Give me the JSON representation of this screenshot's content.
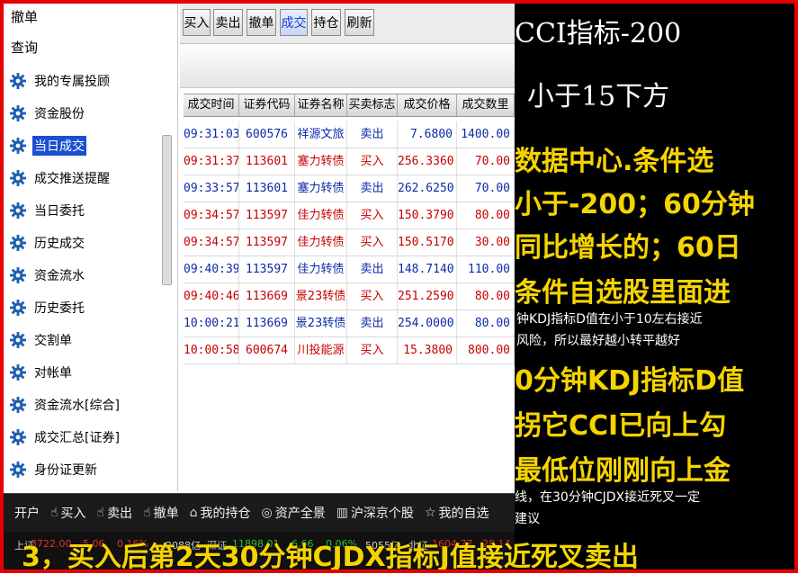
{
  "sidebar": {
    "top_items": [
      "撤单",
      "查询"
    ],
    "items": [
      {
        "label": "我的专属投顾"
      },
      {
        "label": "资金股份"
      },
      {
        "label": "当日成交",
        "active": true
      },
      {
        "label": "成交推送提醒"
      },
      {
        "label": "当日委托"
      },
      {
        "label": "历史成交"
      },
      {
        "label": "资金流水"
      },
      {
        "label": "历史委托"
      },
      {
        "label": "交割单"
      },
      {
        "label": "对帐单"
      },
      {
        "label": "资金流水[综合]"
      },
      {
        "label": "成交汇总[证券]"
      },
      {
        "label": "身份证更新"
      }
    ]
  },
  "toolbar": {
    "buttons": [
      {
        "label": "买入"
      },
      {
        "label": "卖出"
      },
      {
        "label": "撤单"
      },
      {
        "label": "成交",
        "active": true
      },
      {
        "label": "持仓"
      },
      {
        "label": "刷新"
      }
    ]
  },
  "table": {
    "columns": [
      "成交时间",
      "证券代码",
      "证券名称",
      "买卖标志",
      "成交价格",
      "成交数里"
    ],
    "rows": [
      {
        "time": "09:31:03",
        "code": "600576",
        "name": "祥源文旅",
        "side": "卖出",
        "price": "7.6800",
        "qty": "1400.00",
        "type": "sell"
      },
      {
        "time": "09:31:37",
        "code": "113601",
        "name": "塞力转债",
        "side": "买入",
        "price": "256.3360",
        "qty": "70.00",
        "type": "buy"
      },
      {
        "time": "09:33:57",
        "code": "113601",
        "name": "塞力转债",
        "side": "卖出",
        "price": "262.6250",
        "qty": "70.00",
        "type": "sell"
      },
      {
        "time": "09:34:57",
        "code": "113597",
        "name": "佳力转债",
        "side": "买入",
        "price": "150.3790",
        "qty": "80.00",
        "type": "buy"
      },
      {
        "time": "09:34:57",
        "code": "113597",
        "name": "佳力转债",
        "side": "买入",
        "price": "150.5170",
        "qty": "30.00",
        "type": "buy"
      },
      {
        "time": "09:40:39",
        "code": "113597",
        "name": "佳力转债",
        "side": "卖出",
        "price": "148.7140",
        "qty": "110.00",
        "type": "sell"
      },
      {
        "time": "09:40:46",
        "code": "113669",
        "name": "景23转债",
        "side": "买入",
        "price": "251.2590",
        "qty": "80.00",
        "type": "buy"
      },
      {
        "time": "10:00:21",
        "code": "113669",
        "name": "景23转债",
        "side": "卖出",
        "price": "254.0000",
        "qty": "80.00",
        "type": "sell"
      },
      {
        "time": "10:00:58",
        "code": "600674",
        "name": "川投能源",
        "side": "买入",
        "price": "15.3800",
        "qty": "800.00",
        "type": "buy"
      }
    ]
  },
  "bottom_bar": {
    "items": [
      {
        "label": "开户",
        "icon": ""
      },
      {
        "label": "买入",
        "icon": "hand-buy-icon"
      },
      {
        "label": "卖出",
        "icon": "hand-sell-icon"
      },
      {
        "label": "撤单",
        "icon": "hand-cancel-icon"
      },
      {
        "label": "我的持仓",
        "icon": "home-icon"
      },
      {
        "label": "资产全景",
        "icon": "coin-icon"
      },
      {
        "label": "沪深京个股",
        "icon": "stock-icon"
      },
      {
        "label": "我的自选",
        "icon": "star-icon"
      }
    ]
  },
  "index_bar": {
    "segments": [
      {
        "text": "上证",
        "color": "#d0d0d0"
      },
      {
        "text": "3722.00",
        "color": "#e03030"
      },
      {
        "text": "5.06",
        "color": "#e03030"
      },
      {
        "text": "0.16%",
        "color": "#e03030"
      },
      {
        "text": "2088亿",
        "color": "#d0d0d0"
      },
      {
        "text": "深证",
        "color": "#d0d0d0"
      },
      {
        "text": "11898.01",
        "color": "#30c030"
      },
      {
        "text": "6.66",
        "color": "#30c030"
      },
      {
        "text": "0.06%",
        "color": "#30c030"
      },
      {
        "text": "5055亿",
        "color": "#d0d0d0"
      },
      {
        "text": "北证",
        "color": "#d0d0d0"
      },
      {
        "text": "1604.77",
        "color": "#e03030"
      },
      {
        "text": "28.14",
        "color": "#e03030"
      }
    ]
  },
  "overlay": {
    "lines": [
      {
        "text": "CCI指标-200",
        "style": "big"
      },
      {
        "text": "小于15下方",
        "style": "big"
      },
      {
        "text": "数据中心.条件选",
        "style": "yellow"
      },
      {
        "text": "小于-200；60分钟",
        "style": "yellow"
      },
      {
        "text": "同比增长的；60日",
        "style": "yellow"
      },
      {
        "text": "条件自选股里面进",
        "style": "yellow"
      },
      {
        "text": "钟KDJ指标D值在小于10左右接近",
        "style": "small"
      },
      {
        "text": "风险，所以最好越小转平越好",
        "style": "small"
      },
      {
        "text": "0分钟KDJ指标D值",
        "style": "yellow"
      },
      {
        "text": "拐它CCI已向上勾",
        "style": "yellow"
      },
      {
        "text": "最低位刚刚向上金",
        "style": "yellow"
      },
      {
        "text": "线，在30分钟CJDX接近死叉一定",
        "style": "small"
      },
      {
        "text": "建议",
        "style": "small"
      }
    ]
  },
  "subtitle": "3，买入后第2天30分钟CJDX指标J值接近死叉卖出"
}
